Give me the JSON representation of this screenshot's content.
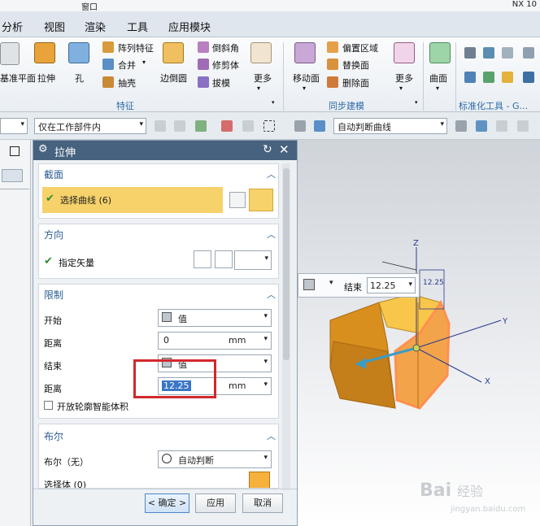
{
  "title": {
    "window_menu": "窗口",
    "app": "NX 10"
  },
  "menu": [
    "分析",
    "视图",
    "渲染",
    "工具",
    "应用模块"
  ],
  "ribbon": {
    "big": [
      {
        "label": "基准平面",
        "icon": "datum-plane-icon"
      },
      {
        "label": "拉伸",
        "icon": "extrude-icon"
      },
      {
        "label": "孔",
        "icon": "hole-icon"
      },
      {
        "label": "边倒圆",
        "icon": "edge-blend-icon"
      },
      {
        "label": "更多",
        "icon": "more-icon"
      },
      {
        "label": "移动面",
        "icon": "move-face-icon"
      },
      {
        "label": "更多",
        "icon": "more-icon"
      },
      {
        "label": "曲面",
        "icon": "surface-icon"
      }
    ],
    "small": [
      {
        "label": "阵列特征",
        "icon": "pattern-feature-icon"
      },
      {
        "label": "合并",
        "icon": "unite-icon"
      },
      {
        "label": "抽壳",
        "icon": "shell-icon"
      },
      {
        "label": "倒斜角",
        "icon": "chamfer-icon"
      },
      {
        "label": "修剪体",
        "icon": "trim-body-icon"
      },
      {
        "label": "拔模",
        "icon": "draft-icon"
      },
      {
        "label": "偏置区域",
        "icon": "offset-region-icon"
      },
      {
        "label": "替换面",
        "icon": "replace-face-icon"
      },
      {
        "label": "删除面",
        "icon": "delete-face-icon"
      }
    ],
    "groups": {
      "feature": "特征",
      "sync": "同步建模",
      "std": "标准化工具 - G..."
    }
  },
  "toolbar": {
    "filter": "仅在工作部件内",
    "curve_rule": "自动判断曲线"
  },
  "dialog": {
    "title": "拉伸",
    "section": {
      "header": "截面",
      "select_curve": "选择曲线 (6)"
    },
    "direction": {
      "header": "方向",
      "specify_vector": "指定矢量"
    },
    "limits": {
      "header": "限制",
      "start_label": "开始",
      "start_value": "值",
      "start_dist_label": "距离",
      "start_dist": "0",
      "start_unit": "mm",
      "end_label": "结束",
      "end_value": "值",
      "end_dist_label": "距离",
      "end_dist": "12.25",
      "end_unit": "mm",
      "open_profile": "开放轮廓智能体积"
    },
    "boolean": {
      "header": "布尔",
      "label": "布尔（无）",
      "value": "自动判断",
      "select_body": "选择体 (0)"
    },
    "buttons": {
      "ok": "< 确定 >",
      "apply": "应用",
      "cancel": "取消"
    }
  },
  "viewport": {
    "float_label": "结束",
    "float_value": "12.25",
    "dim_label": "12.25",
    "axis": {
      "x": "X",
      "y": "Y",
      "z": "Z"
    }
  },
  "watermark": {
    "brand": "Bai",
    "brand2": "经验",
    "url": "jingyan.baidu.com"
  },
  "colors": {
    "accent": "#2b5d94",
    "selection": "#f7d26a",
    "highlight": "#d2282c",
    "header": "#46627e"
  }
}
